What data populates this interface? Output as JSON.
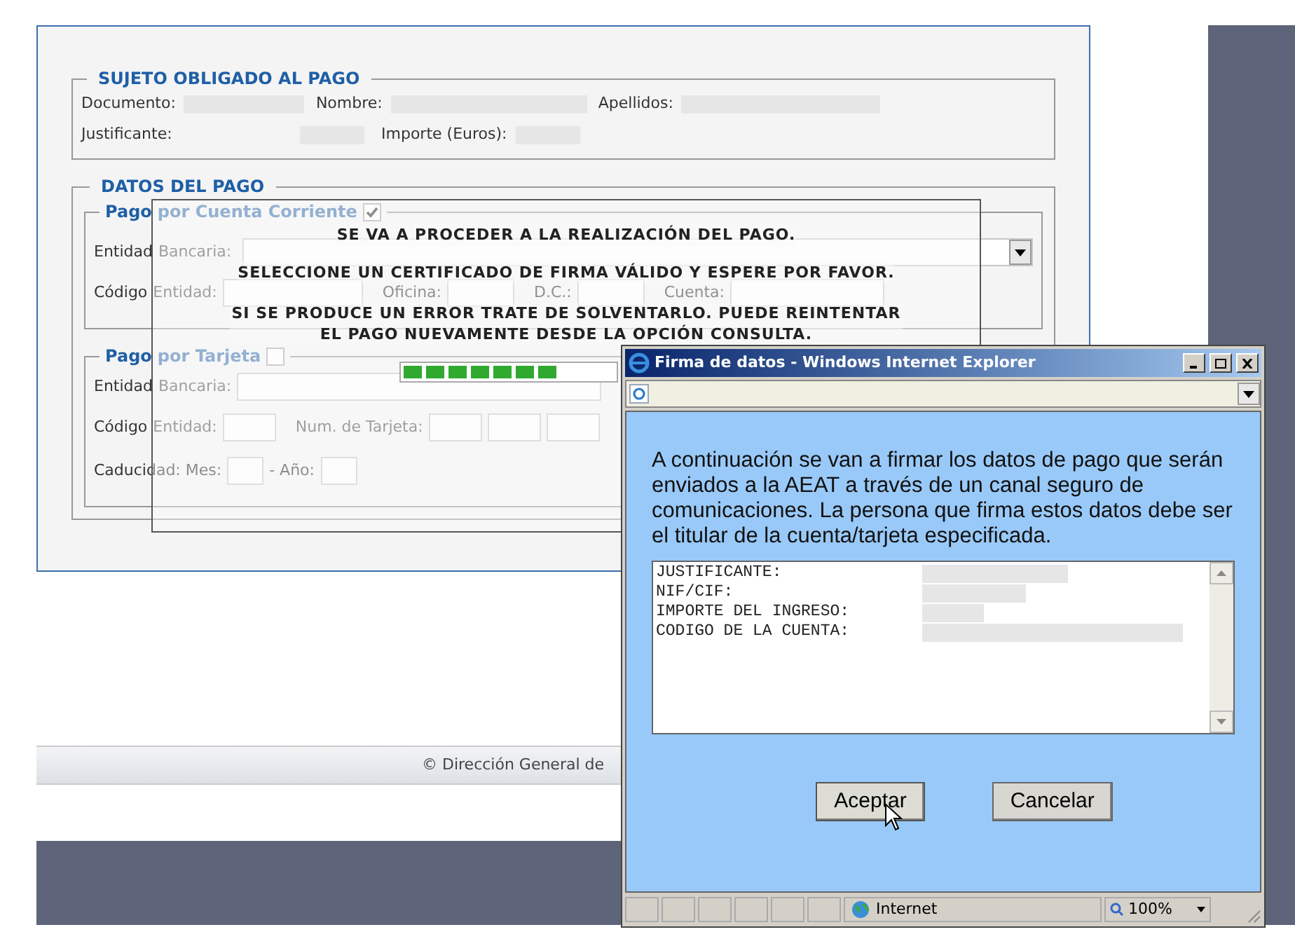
{
  "sujeto": {
    "legend": "SUJETO OBLIGADO AL PAGO",
    "row1": [
      {
        "label": "Documento:"
      },
      {
        "label": "Nombre:"
      },
      {
        "label": "Apellidos:"
      }
    ],
    "row2": [
      {
        "label": "Justificante:"
      },
      {
        "label": "Importe (Euros):"
      }
    ]
  },
  "datos": {
    "legend": "DATOS DEL PAGO",
    "cuenta": {
      "legend_bold": "Pago",
      "legend_rest": "por Cuenta Corriente",
      "checked": true,
      "bank_prefix": "Entidad",
      "bank_rest": "Bancaria:",
      "code_prefix": "Código",
      "code_labels": [
        "Entidad:",
        "Oficina:",
        "D.C.:",
        "Cuenta:"
      ]
    },
    "tarjeta": {
      "legend_bold": "Pago",
      "legend_rest": "por Tarjeta",
      "checked": false,
      "bank_prefix": "Entidad",
      "bank_rest": "Bancaria:",
      "code_prefix": "Código",
      "code_labels": [
        "Entidad:",
        "Num. de Tarjeta:"
      ],
      "expiry_label": "Caducidad: Mes:",
      "year_label": "- Año:"
    }
  },
  "message": {
    "lines": [
      "SE VA A PROCEDER A LA REALIZACIÓN DEL PAGO.",
      "SELECCIONE UN CERTIFICADO DE FIRMA VÁLIDO Y ESPERE POR FAVOR.",
      "SI SE PRODUCE UN ERROR TRATE DE SOLVENTARLO. PUEDE REINTENTAR EL PAGO NUEVAMENTE DESDE LA OPCIÓN CONSULTA."
    ],
    "progress": {
      "level": 0.73
    }
  },
  "footer": {
    "copyright": "© Dirección General de"
  },
  "ie_window": {
    "title": "Firma de datos - Windows Internet Explorer",
    "intro": "A continuación se van a firmar los datos de pago que serán enviados a la AEAT a través de un canal seguro de comunicaciones. La persona que firma estos datos debe ser el titular de la cuenta/tarjeta especificada.",
    "details": [
      {
        "label": "JUSTIFICANTE:"
      },
      {
        "label": "NIF/CIF:"
      },
      {
        "label": "IMPORTE DEL INGRESO:"
      },
      {
        "label": "CODIGO DE LA CUENTA:"
      }
    ],
    "buttons": [
      {
        "label": "Aceptar",
        "kind": "hovered"
      },
      {
        "label": "Cancelar",
        "kind": "normal"
      }
    ],
    "status": {
      "zone": "Internet",
      "zoom": "100%"
    }
  }
}
